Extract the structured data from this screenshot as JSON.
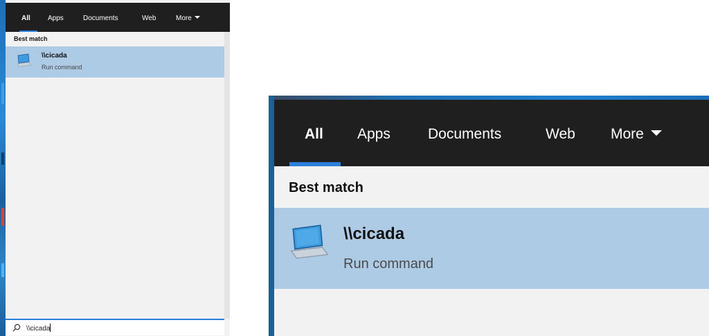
{
  "tabs": [
    {
      "label": "All",
      "active": true
    },
    {
      "label": "Apps",
      "active": false
    },
    {
      "label": "Documents",
      "active": false
    },
    {
      "label": "Web",
      "active": false
    },
    {
      "label": "More",
      "active": false
    }
  ],
  "best_match_label": "Best match",
  "result": {
    "title": "\\\\cicada",
    "subtitle": "Run command",
    "icon": "computer-monitor-icon"
  },
  "search": {
    "value": "\\\\cicada",
    "icon": "search-icon"
  },
  "colors": {
    "tab_bar": "#1f1f1f",
    "accent": "#2b7fd8",
    "selection": "#aecbe6",
    "panel_bg": "#f2f2f2"
  }
}
